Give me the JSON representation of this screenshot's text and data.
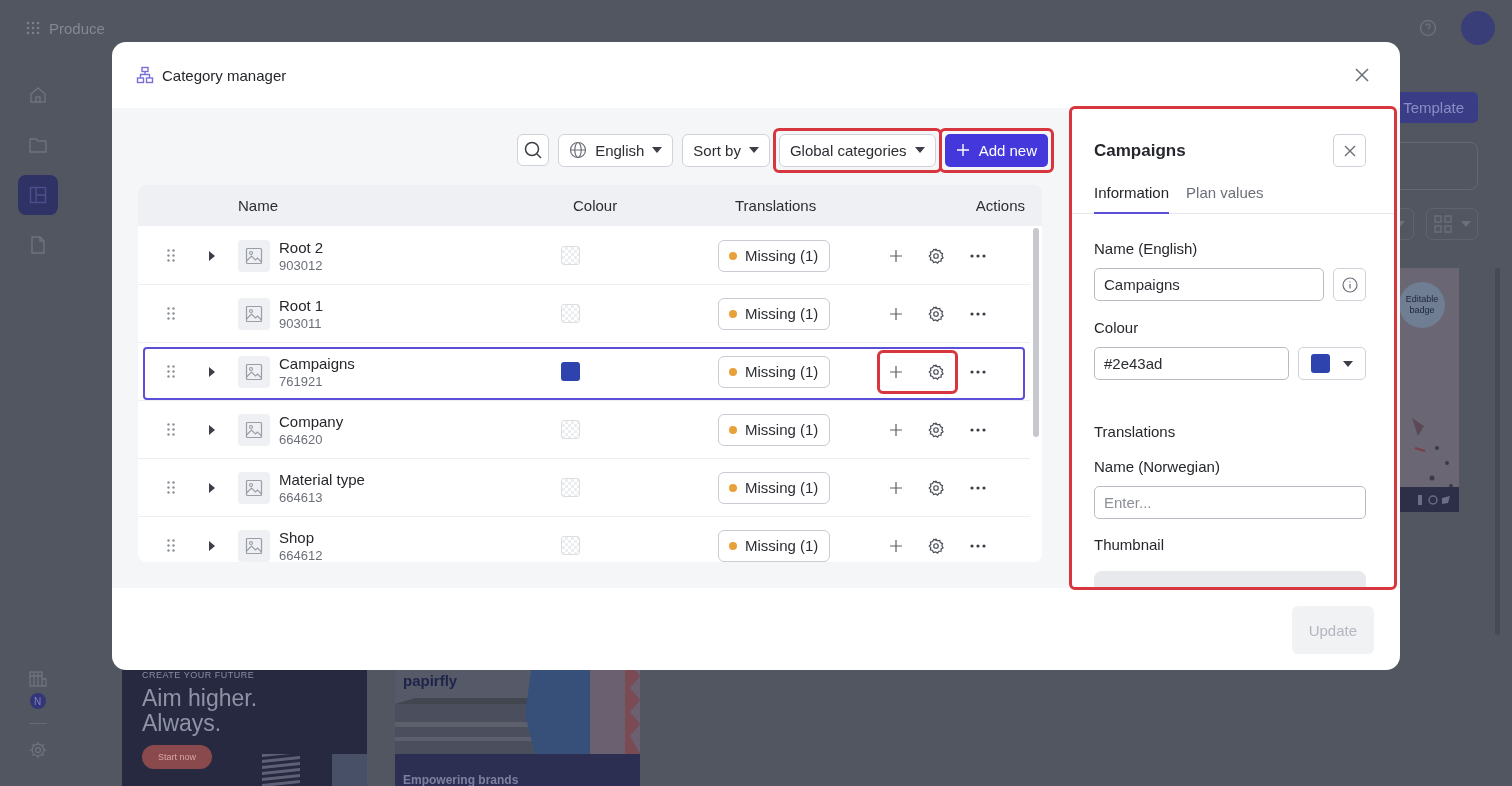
{
  "app": {
    "brand": "Produce",
    "sidebar": [
      {
        "selected": false
      },
      {
        "selected": false
      },
      {
        "selected": true
      },
      {
        "selected": false
      }
    ],
    "sidebar_badge": "N",
    "toolbar_button": "Template",
    "cards": [
      {
        "kind": "badge",
        "badge": "Editable badge"
      },
      {
        "kind": "promo",
        "eyebrow": "CREATE YOUR FUTURE",
        "headline": "Aim higher. Always.",
        "button": "Start now"
      },
      {
        "kind": "brand",
        "logo": "papirfly",
        "headline": "Empowering brands"
      }
    ]
  },
  "modal": {
    "title": "Category manager",
    "toolbar": {
      "language": "English",
      "sort": "Sort by",
      "filter": {
        "label": "Global categories",
        "highlighted": true
      },
      "add": {
        "label": "Add new",
        "highlighted": true
      }
    },
    "table": {
      "columns": [
        "Name",
        "Colour",
        "Translations",
        "Actions"
      ],
      "rows": [
        {
          "name": "Root 2",
          "id": "903012",
          "expandable": true,
          "translations": "Missing (1)",
          "selected": false,
          "actions_highlighted": false
        },
        {
          "name": "Root 1",
          "id": "903011",
          "expandable": false,
          "translations": "Missing (1)",
          "selected": false,
          "actions_highlighted": false
        },
        {
          "name": "Campaigns",
          "id": "761921",
          "expandable": true,
          "color": "#2e43ad",
          "translations": "Missing (1)",
          "selected": true,
          "actions_highlighted": true
        },
        {
          "name": "Company",
          "id": "664620",
          "expandable": true,
          "translations": "Missing (1)",
          "selected": false,
          "actions_highlighted": false
        },
        {
          "name": "Material type",
          "id": "664613",
          "expandable": true,
          "translations": "Missing (1)",
          "selected": false,
          "actions_highlighted": false
        },
        {
          "name": "Shop",
          "id": "664612",
          "expandable": true,
          "translations": "Missing (1)",
          "selected": false,
          "actions_highlighted": false
        }
      ]
    },
    "detail": {
      "title": "Campaigns",
      "highlighted": true,
      "tabs": [
        {
          "label": "Information",
          "selected": true
        },
        {
          "label": "Plan values",
          "selected": false
        }
      ],
      "name_label": "Name (English)",
      "name_value": "Campaigns",
      "colour_label": "Colour",
      "colour_value": "#2e43ad",
      "translations_heading": "Translations",
      "translation_label": "Name (Norwegian)",
      "translation_placeholder": "Enter...",
      "thumbnail_label": "Thumbnail"
    },
    "footer": {
      "button": "Update",
      "disabled": true
    }
  }
}
